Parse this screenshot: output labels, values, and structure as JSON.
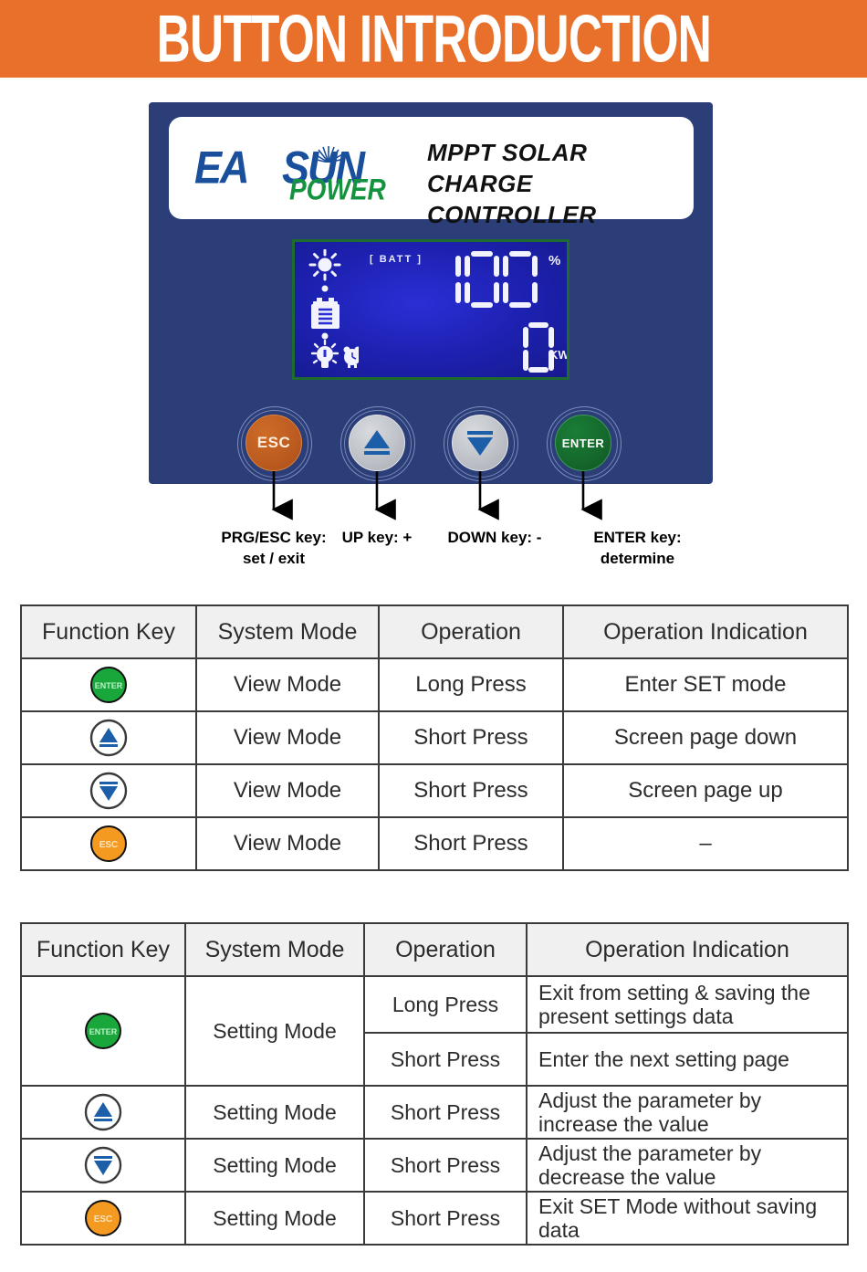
{
  "header": {
    "title": "BUTTON INTRODUCTION",
    "background_color": "#E8702A",
    "text_color": "#FFFFFF"
  },
  "device": {
    "panel_color": "#2B3E78",
    "brand": {
      "logo_ea": "EA",
      "logo_sun": "SUN",
      "logo_power": "POWER",
      "logo_blue": "#1A4F9C",
      "logo_green": "#14933F"
    },
    "product_name_line1": "MPPT SOLAR",
    "product_name_line2": "CHARGE CONTROLLER",
    "lcd": {
      "backlight_color": "#1C20A8",
      "bezel_color": "#1D6B2E",
      "batt_label": "[ BATT ]",
      "battery_percent": "100",
      "percent_unit": "%",
      "power_value": "0",
      "power_unit": "KW",
      "icons": [
        "sun-icon",
        "battery-icon",
        "light-bulb-icon",
        "alarm-clock-icon"
      ]
    },
    "buttons": [
      {
        "name": "esc-button",
        "label": "ESC",
        "color": "#BC5B20"
      },
      {
        "name": "up-button",
        "label": "",
        "color": "#BCC0C6"
      },
      {
        "name": "down-button",
        "label": "",
        "color": "#BCC0C6"
      },
      {
        "name": "enter-button",
        "label": "ENTER",
        "color": "#15682C"
      }
    ]
  },
  "captions": [
    "PRG/ESC key:\nset / exit",
    "UP key: +",
    "DOWN key: -",
    "ENTER key:\ndetermine"
  ],
  "table1": {
    "headers": [
      "Function Key",
      "System Mode",
      "Operation",
      "Operation Indication"
    ],
    "rows": [
      {
        "key": "enter",
        "mode": "View Mode",
        "operation": "Long Press",
        "indication": "Enter SET mode"
      },
      {
        "key": "up",
        "mode": "View Mode",
        "operation": "Short Press",
        "indication": "Screen page down"
      },
      {
        "key": "down",
        "mode": "View Mode",
        "operation": "Short Press",
        "indication": "Screen page up"
      },
      {
        "key": "esc",
        "mode": "View Mode",
        "operation": "Short Press",
        "indication": "–"
      }
    ]
  },
  "table2": {
    "headers": [
      "Function Key",
      "System Mode",
      "Operation",
      "Operation Indication"
    ],
    "rows": [
      {
        "key": "enter",
        "mode": "Setting Mode",
        "operation": "Long Press",
        "indication": "Exit from setting & saving the present settings data"
      },
      {
        "key": "",
        "mode": "",
        "operation": "Short Press",
        "indication": "Enter the next setting page"
      },
      {
        "key": "up",
        "mode": "Setting Mode",
        "operation": "Short Press",
        "indication": "Adjust the parameter by increase the value"
      },
      {
        "key": "down",
        "mode": "Setting Mode",
        "operation": "Short Press",
        "indication": "Adjust the parameter by decrease the value"
      },
      {
        "key": "esc",
        "mode": "Setting Mode",
        "operation": "Short Press",
        "indication": "Exit SET Mode without saving data"
      }
    ]
  },
  "table_icon_colors": {
    "enter": "#19A73B",
    "esc": "#F49A20",
    "arrow": "#1C5FA8"
  }
}
